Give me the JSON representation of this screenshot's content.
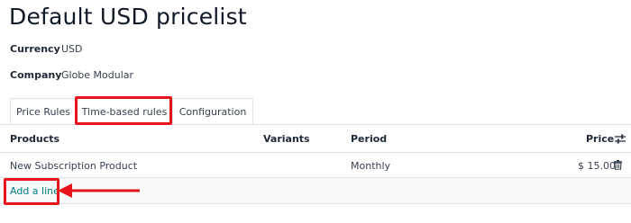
{
  "page_title": "Default USD pricelist",
  "fields": {
    "currency_label": "Currency",
    "currency_value": "USD",
    "company_label": "Company",
    "company_value": "Globe Modular"
  },
  "tabs": [
    {
      "label": "Price Rules",
      "active": false
    },
    {
      "label": "Time-based rules",
      "active": true
    },
    {
      "label": "Configuration",
      "active": false
    }
  ],
  "table": {
    "columns": [
      "Products",
      "Variants",
      "Period",
      "Price"
    ],
    "rows": [
      {
        "product": "New Subscription Product",
        "variants": "",
        "period": "Monthly",
        "price": "$ 15.00"
      }
    ],
    "add_line_label": "Add a line"
  },
  "icons": {
    "column_settings": "sliders-icon",
    "delete": "trash-icon"
  },
  "colors": {
    "highlight": "#e8141b",
    "link": "#017e84"
  }
}
